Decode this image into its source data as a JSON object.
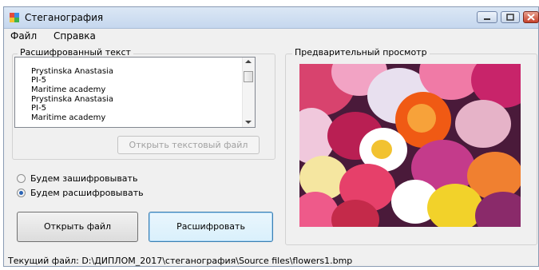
{
  "window": {
    "title": "Стеганография",
    "icon": "app-icon",
    "controls": [
      "minimize-icon",
      "maximize-icon",
      "close-icon"
    ]
  },
  "menu": {
    "file": "Файл",
    "help": "Справка"
  },
  "decrypted_group": {
    "label": "Расшифрованный текст",
    "lines": [
      "Prystinska Anastasia",
      "PI-5",
      "Maritime academy",
      "Prystinska Anastasia",
      "PI-5",
      "Maritime academy"
    ],
    "open_text_button": "Открыть текстовый файл",
    "open_text_button_enabled": false
  },
  "mode": {
    "encrypt_label": "Будем зашифровывать",
    "decrypt_label": "Будем расшифровывать",
    "selected": "decrypt"
  },
  "buttons": {
    "open_file": "Открыть файл",
    "decrypt": "Расшифровать"
  },
  "preview_group": {
    "label": "Предварительный просмотр",
    "image": "flowers-photo"
  },
  "status": {
    "text": "Текущий файл: D:\\ДИПЛОМ_2017\\стеганография\\Source files\\flowers1.bmp"
  },
  "colors": {
    "radio_dot": "#2a63b5",
    "close_button": "#c6402a"
  }
}
